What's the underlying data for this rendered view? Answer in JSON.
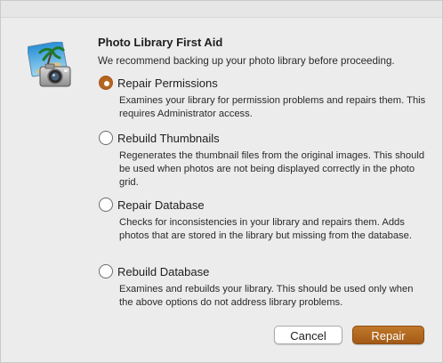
{
  "dialog": {
    "title": "Photo Library First Aid",
    "subtitle": "We recommend backing up your photo library before proceeding.",
    "icon": "photo-library-camera-icon"
  },
  "options": [
    {
      "label": "Repair Permissions",
      "selected": true,
      "description": "Examines your library for permission problems and repairs them. This requires Administrator access."
    },
    {
      "label": "Rebuild Thumbnails",
      "selected": false,
      "description": "Regenerates the thumbnail files from the original images. This should be used when photos are not being displayed correctly in the photo grid."
    },
    {
      "label": "Repair Database",
      "selected": false,
      "description": "Checks for inconsistencies in your library and repairs them. Adds photos that are stored in the library but missing from the database."
    },
    {
      "label": "Rebuild Database",
      "selected": false,
      "description": "Examines and rebuilds your library. This should be used only when the above options do not address library problems."
    }
  ],
  "buttons": {
    "cancel_label": "Cancel",
    "repair_label": "Repair"
  },
  "colors": {
    "accent": "#b5651d",
    "dialog_background": "#ececec"
  }
}
